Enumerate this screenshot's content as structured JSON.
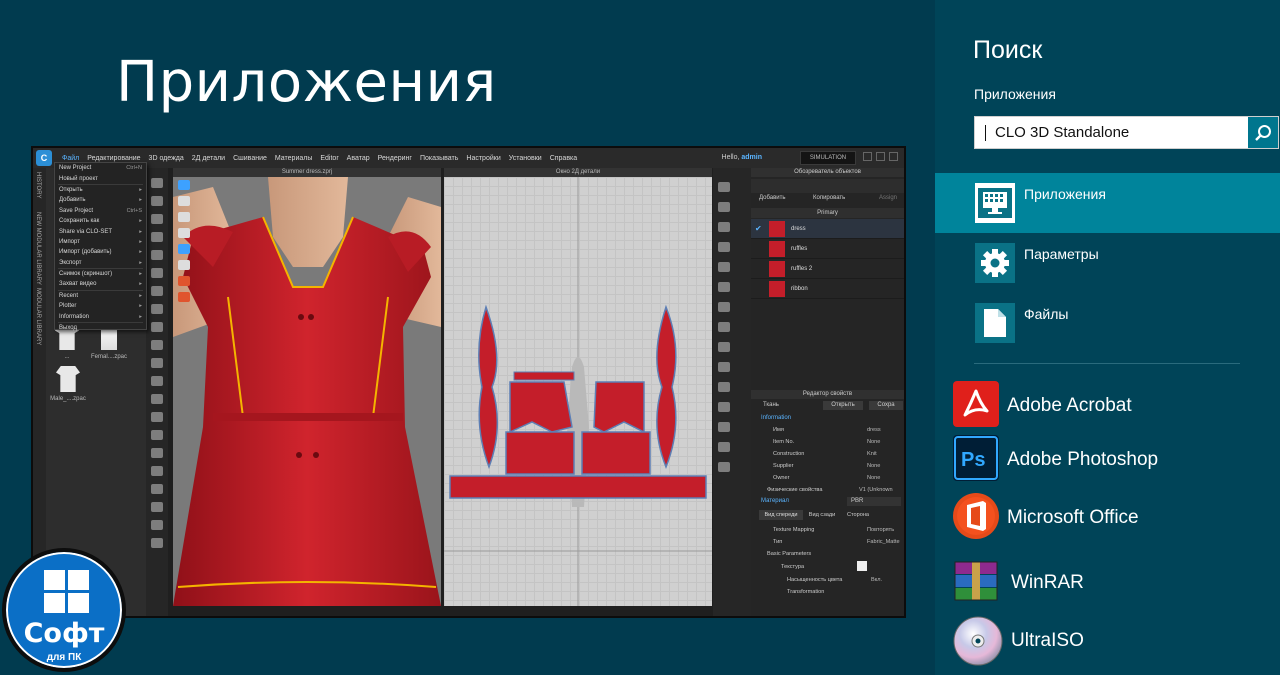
{
  "start": {
    "title": "Приложения"
  },
  "clo": {
    "menu": [
      "Файл",
      "Редактирование",
      "3D одежда",
      "2Д детали",
      "Сшивание",
      "Материалы",
      "Editor",
      "Аватар",
      "Рендеринг",
      "Показывать",
      "Настройки",
      "Установки",
      "Справка"
    ],
    "hello": "Hello,",
    "user": "admin",
    "simulation": "SIMULATION",
    "vertical_tabs": [
      "HISTORY",
      "NEW MODULAR LIBRARY",
      "MODULAR LIBRARY"
    ],
    "file_menu": [
      {
        "label": "New Project",
        "shortcut": "Ctrl+N"
      },
      {
        "label": "Новый проект",
        "shortcut": ""
      },
      {
        "label": "Открыть",
        "shortcut": "▸"
      },
      {
        "label": "Добавить",
        "shortcut": "▸"
      },
      {
        "label": "Save Project",
        "shortcut": "Ctrl+S"
      },
      {
        "label": "Сохранить как",
        "shortcut": "▸"
      },
      {
        "label": "Share via CLO-SET",
        "shortcut": "▸"
      },
      {
        "label": "Импорт",
        "shortcut": "▸"
      },
      {
        "label": "Импорт (добавить)",
        "shortcut": "▸"
      },
      {
        "label": "Экспорт",
        "shortcut": "▸"
      },
      {
        "label": "Снимок (скриншот)",
        "shortcut": "▸"
      },
      {
        "label": "Захват видео",
        "shortcut": "▸"
      },
      {
        "label": "Recent",
        "shortcut": "▸"
      },
      {
        "label": "Plotter",
        "shortcut": "▸"
      },
      {
        "label": "Information",
        "shortcut": "▸"
      },
      {
        "label": "Выход",
        "shortcut": ""
      }
    ],
    "library_items": [
      {
        "label": "..."
      },
      {
        "label": "Femal....zpac"
      },
      {
        "label": "Male_....zpac"
      }
    ],
    "view3d_title": "Summer dress.zprj",
    "view2d_title": "Окно 2Д детали",
    "object_browser": {
      "title": "Обозреватель объектов",
      "add": "Добавить",
      "copy": "Копировать",
      "assign": "Assign",
      "header": "Primary",
      "fabrics": [
        "dress",
        "ruffles",
        "ruffles 2",
        "ribbon"
      ]
    },
    "property_editor": {
      "title": "Редактор свойств",
      "fabric_label": "Ткань",
      "open": "Открыть",
      "save": "Сохра",
      "information": "Information",
      "rows": [
        {
          "k": "Имя",
          "v": "dress"
        },
        {
          "k": "Item No.",
          "v": "None"
        },
        {
          "k": "Construction",
          "v": "Knit"
        },
        {
          "k": "Supplier",
          "v": "None"
        },
        {
          "k": "Owner",
          "v": "None"
        },
        {
          "k": "Физические свойства",
          "v": "V1 (Unknown"
        }
      ],
      "material": "Материал",
      "material_value": "PBR",
      "tabs": [
        "Вид спереди",
        "Вид сзади",
        "Сторона"
      ],
      "rows2": [
        {
          "k": "Texture Mapping",
          "v": "Повторять"
        },
        {
          "k": "Тип",
          "v": "Fabric_Matte"
        },
        {
          "k": "Basic Parameters",
          "v": ""
        },
        {
          "k": "Текстура",
          "v": ""
        },
        {
          "k": "Насыщенность цвета",
          "v": "Вкл."
        },
        {
          "k": "Transformation",
          "v": ""
        }
      ]
    }
  },
  "logo": {
    "line1": "Софт",
    "line2": "для ПК"
  },
  "search": {
    "title": "Поиск",
    "scope": "Приложения",
    "query": "CLO 3D Standalone",
    "categories": [
      {
        "label": "Приложения",
        "icon": "monitor-icon"
      },
      {
        "label": "Параметры",
        "icon": "gear-icon"
      },
      {
        "label": "Файлы",
        "icon": "file-icon"
      }
    ],
    "apps": [
      {
        "label": "Adobe Acrobat",
        "color": "#e0201b"
      },
      {
        "label": "Adobe Photoshop",
        "color": "#001e36"
      },
      {
        "label": "Microsoft Office",
        "color": "#e64a19"
      },
      {
        "label": "WinRAR",
        "color": "#8e2a8e"
      },
      {
        "label": "UltraISO",
        "color": "#b0b0b0"
      }
    ]
  },
  "colors": {
    "background": "#013b4f",
    "charm": "#004458",
    "accent": "#00849b",
    "fabric": "#c41e2a"
  }
}
